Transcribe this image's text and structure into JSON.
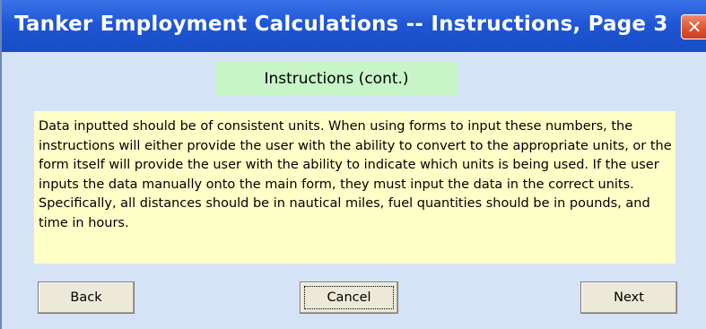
{
  "window": {
    "title": "Tanker Employment Calculations -- Instructions, Page 3",
    "close_glyph": "✕",
    "close_icon": "close-icon"
  },
  "heading": "Instructions (cont.)",
  "instructions_text": "Data inputted should be of consistent units.  When using forms to input these numbers, the instructions will either provide the user with the ability to convert to the appropriate units, or the form itself will provide the user with the ability to indicate which units is being used.  If the user inputs the data manually onto the main form, they must input the data in the correct units.  Specifically, all distances should be in nautical miles, fuel quantities should be in pounds, and time in hours.",
  "buttons": {
    "back": "Back",
    "cancel": "Cancel",
    "next": "Next"
  },
  "colors": {
    "titlebar": "#1f56d6",
    "client_bg": "#d6e2f5",
    "heading_bg": "#c8f5c8",
    "instructions_bg": "#ffffc8",
    "close_button": "#e0502e"
  }
}
